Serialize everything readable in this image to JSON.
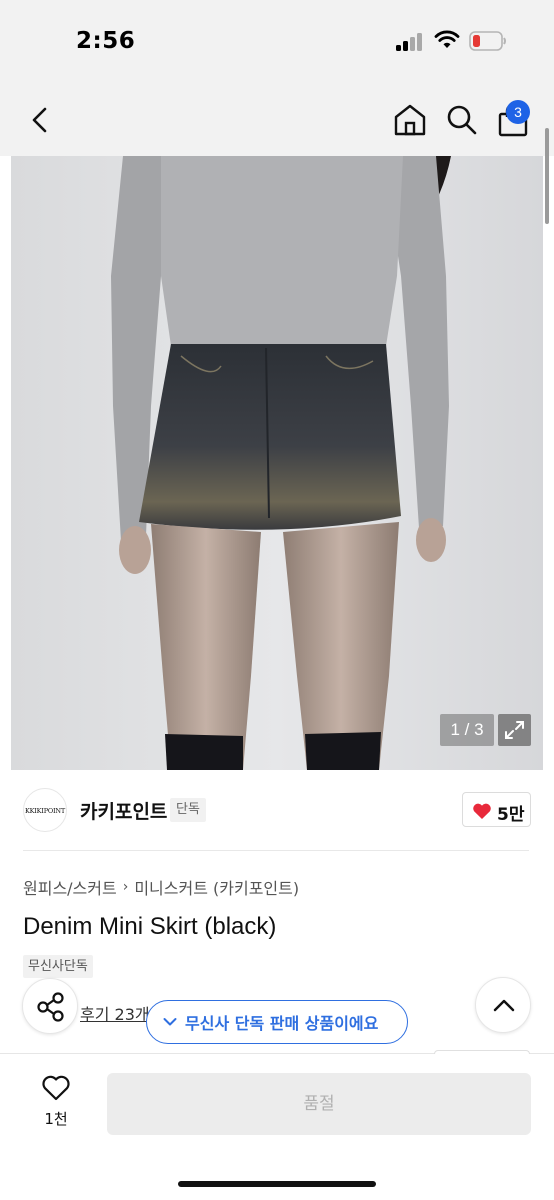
{
  "status_bar": {
    "time": "2:56",
    "icons": [
      "cellular-signal-icon",
      "wifi-icon",
      "battery-low-icon"
    ],
    "battery_color": "#e53935"
  },
  "nav": {
    "icons": [
      "chevron-left-icon",
      "home-icon",
      "search-icon",
      "shopping-bag-icon"
    ],
    "cart_badge": "3",
    "badge_color": "#1e63e6"
  },
  "gallery": {
    "counter": "1 / 3",
    "expand_icon": "expand-icon"
  },
  "brand": {
    "logo_text": "KKIKIPOINT",
    "name": "카키포인트",
    "tag": "단독"
  },
  "like": {
    "count": "5만",
    "heart_color": "#e8293b"
  },
  "breadcrumb": {
    "items": [
      "원피스/스커트",
      "미니스커트 (카키포인트)"
    ],
    "separator": "›"
  },
  "product": {
    "title": "Denim Mini Skirt (black)",
    "exclusive_tag": "무신사단독"
  },
  "reviews": {
    "label": "후기 23개"
  },
  "exclusive_banner": {
    "text": "무신사 단독 판매 상품이에요",
    "accent_color": "#2f6fe0"
  },
  "bottom_bar": {
    "wish_count": "1천",
    "buy_label": "품절"
  }
}
